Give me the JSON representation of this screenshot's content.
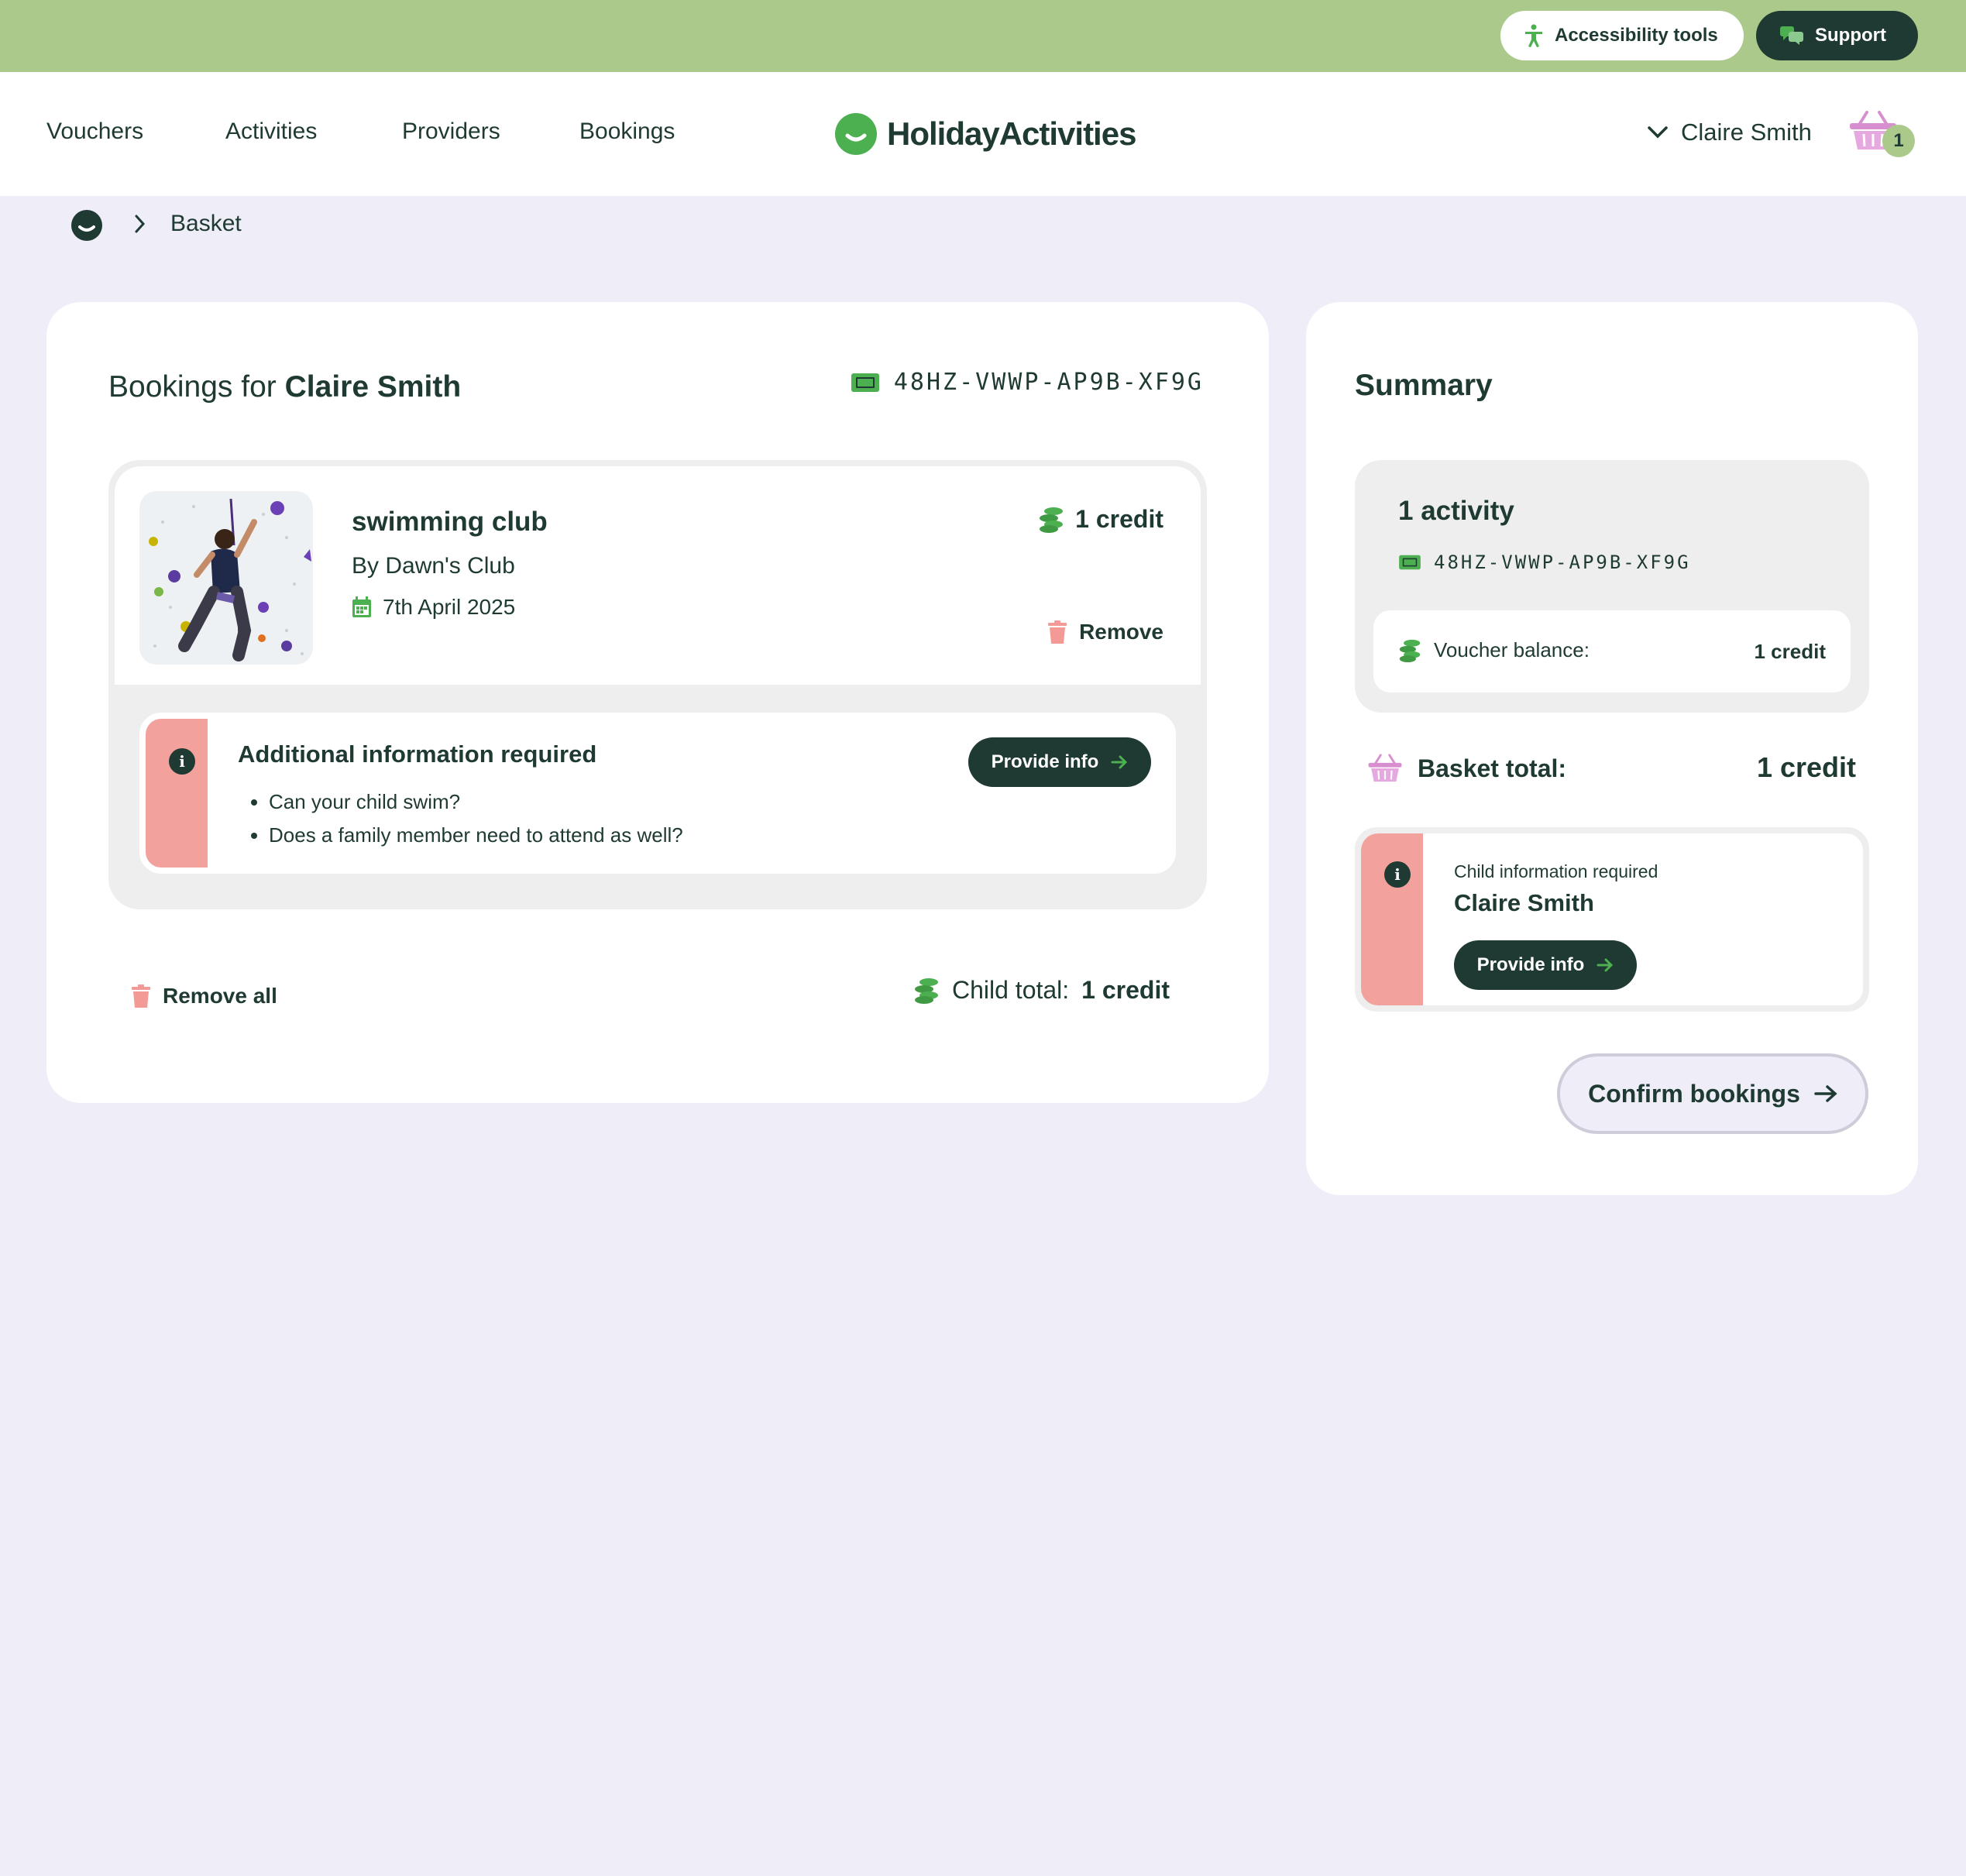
{
  "topbar": {
    "accessibility_label": "Accessibility tools",
    "support_label": "Support"
  },
  "nav": {
    "items": [
      "Vouchers",
      "Activities",
      "Providers",
      "Bookings"
    ],
    "logo_text": "HolidayActivities",
    "user_name": "Claire Smith",
    "basket_count": "1"
  },
  "breadcrumb": {
    "current": "Basket"
  },
  "bookings": {
    "title_prefix": "Bookings for",
    "child_name": "Claire Smith",
    "voucher_code": "48HZ-VWWP-AP9B-XF9G",
    "item": {
      "name": "swimming club",
      "provider": "By Dawn's Club",
      "date": "7th April 2025",
      "credit": "1 credit",
      "remove_label": "Remove",
      "image_alt": "climbing-wall-photo"
    },
    "info": {
      "title": "Additional information required",
      "questions": [
        "Can your child swim?",
        "Does a family member need to attend as well?"
      ],
      "button_label": "Provide info"
    },
    "remove_all_label": "Remove all",
    "child_total_label": "Child total:",
    "child_total_value": "1 credit"
  },
  "summary": {
    "title": "Summary",
    "activity_count": "1 activity",
    "voucher_code": "48HZ-VWWP-AP9B-XF9G",
    "voucher_balance_label": "Voucher balance:",
    "voucher_balance_value": "1 credit",
    "basket_total_label": "Basket total:",
    "basket_total_value": "1 credit",
    "child_info_label": "Child information required",
    "child_info_name": "Claire Smith",
    "child_info_button": "Provide info",
    "confirm_label": "Confirm bookings"
  },
  "colors": {
    "topbar": "#abc98b",
    "dark": "#1e3a33",
    "accent_green": "#4caf50",
    "alert_stripe": "#f3a19c",
    "basket_pink": "#d88fcf",
    "background": "#efedf7"
  }
}
